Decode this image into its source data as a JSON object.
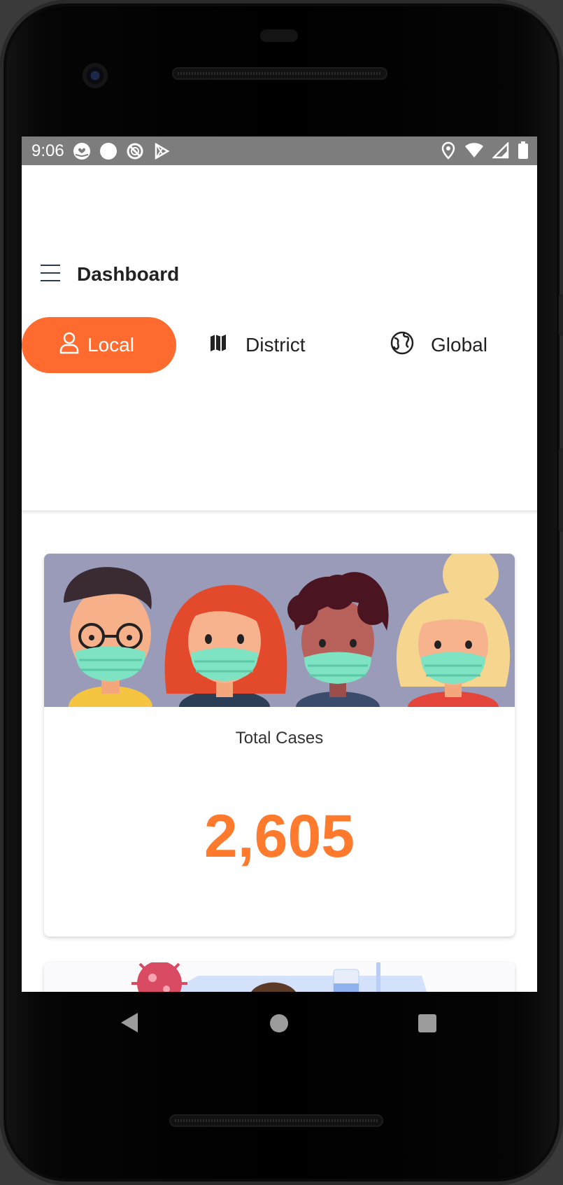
{
  "status_bar": {
    "time": "9:06",
    "left_icons": [
      "hand-heart-icon",
      "circle-icon",
      "blocked-icon",
      "play-store-icon"
    ],
    "right_icons": [
      "location-icon",
      "wifi-icon",
      "signal-icon",
      "battery-icon"
    ]
  },
  "app_bar": {
    "menu_icon": "hamburger-menu-icon",
    "title": "Dashboard"
  },
  "tabs": [
    {
      "label": "Local",
      "icon": "user-icon",
      "selected": true
    },
    {
      "label": "District",
      "icon": "map-icon",
      "selected": false
    },
    {
      "label": "Global",
      "icon": "globe-icon",
      "selected": false
    }
  ],
  "cards": [
    {
      "label": "Total Cases",
      "value": "2,605",
      "image": "masked-people-illustration"
    },
    {
      "label": "",
      "value": "",
      "image": "hospital-patient-illustration"
    }
  ],
  "colors": {
    "accent": "#ff6b2f",
    "value_color": "#ff7a2d",
    "status_bar": "#7d7d7d",
    "banner_bg": "#9a9ab9"
  },
  "nav_bar": [
    "back-icon",
    "home-icon",
    "recents-icon"
  ]
}
